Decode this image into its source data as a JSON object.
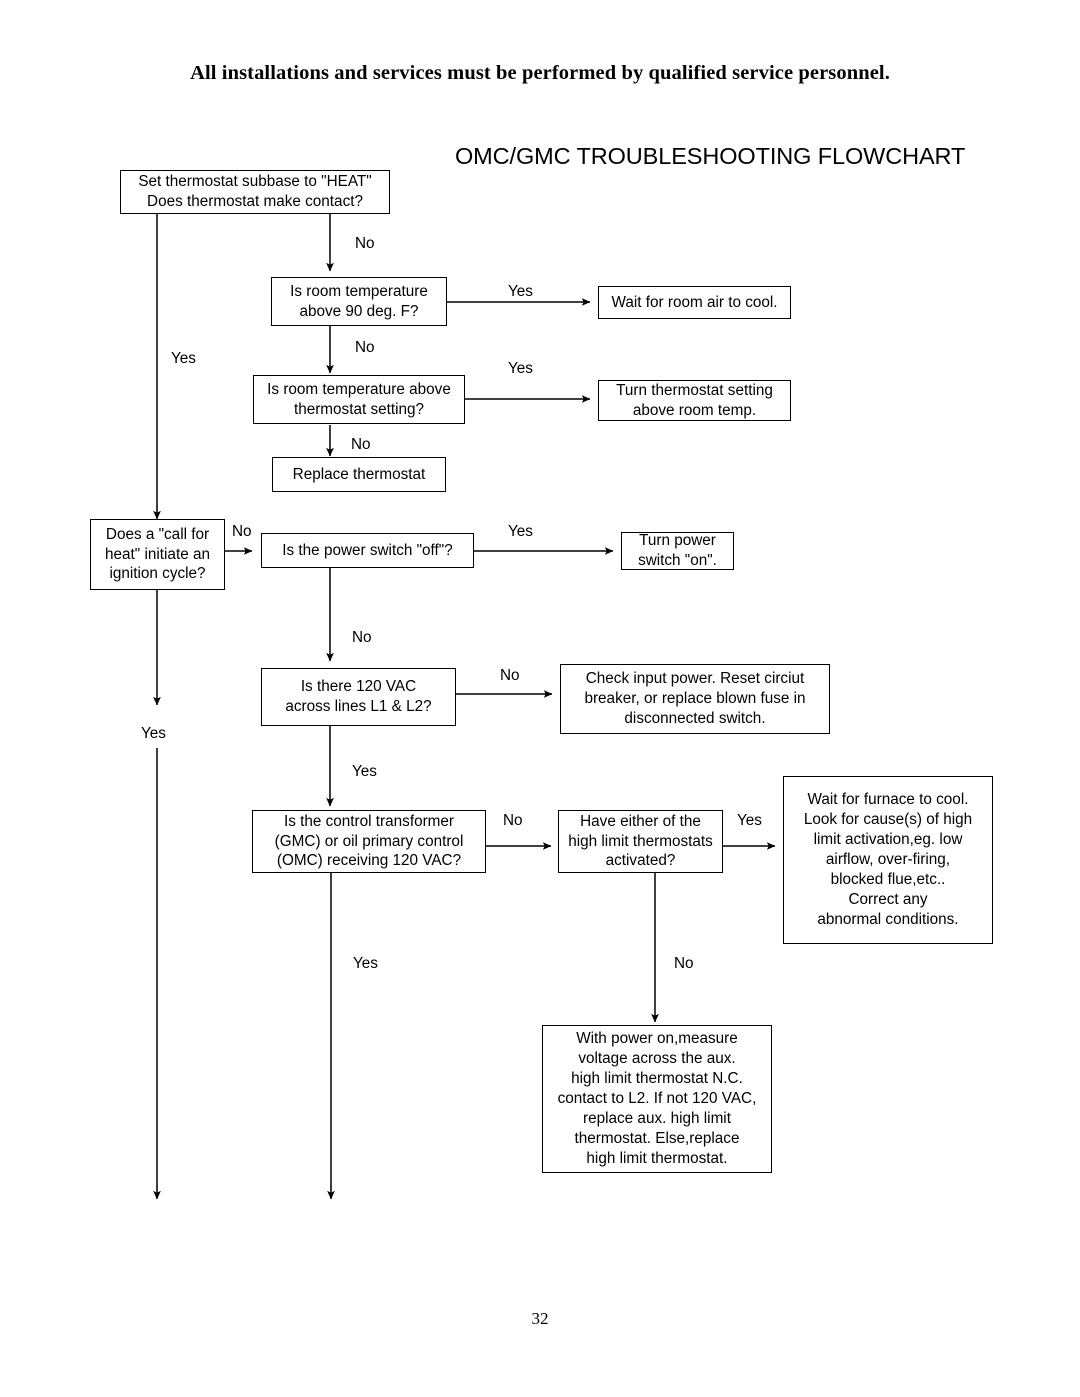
{
  "notice": "All installations and services must be performed by qualified service personnel.",
  "chart_title": "OMC/GMC TROUBLESHOOTING FLOWCHART",
  "page_number": "32",
  "nodes": [
    {
      "id": "set-thermostat",
      "text": "Set thermostat subbase to \"HEAT\"\nDoes thermostat make contact?"
    },
    {
      "id": "room-above-90",
      "text": "Is room temperature\nabove 90 deg. F?"
    },
    {
      "id": "wait-room-air-cool",
      "text": "Wait for room air to cool."
    },
    {
      "id": "room-above-setting",
      "text": "Is room temperature above\nthermostat setting?"
    },
    {
      "id": "turn-thermostat-up",
      "text": "Turn thermostat setting\nabove room temp."
    },
    {
      "id": "replace-thermostat",
      "text": "Replace thermostat"
    },
    {
      "id": "call-for-heat",
      "text": "Does a \"call for\nheat\" initiate an\nignition cycle?"
    },
    {
      "id": "power-switch-off",
      "text": "Is the power switch \"off\"?"
    },
    {
      "id": "turn-power-on",
      "text": "Turn power\nswitch \"on\"."
    },
    {
      "id": "is-120-vac-l1-l2",
      "text": "Is there 120 VAC\nacross lines L1 & L2?"
    },
    {
      "id": "check-input-power",
      "text": "Check input power. Reset circiut\nbreaker, or replace blown fuse in\ndisconnected switch."
    },
    {
      "id": "control-transformer",
      "text": "Is the control transformer\n(GMC) or oil primary control\n(OMC) receiving 120 VAC?"
    },
    {
      "id": "high-limit-activated",
      "text": "Have either of the\nhigh limit thermostats\nactivated?"
    },
    {
      "id": "wait-furnace-cool",
      "text": "Wait for furnace to cool.\nLook for cause(s) of high\nlimit  activation,eg. low\nairflow, over-firing,\nblocked flue,etc..\nCorrect any\nabnormal conditions."
    },
    {
      "id": "measure-aux-voltage",
      "text": "With power on,measure\nvoltage across the aux.\nhigh limit thermostat N.C.\ncontact to L2. If not 120 VAC,\nreplace aux. high limit\nthermostat. Else,replace\nhigh limit thermostat."
    }
  ],
  "edge_labels": [
    {
      "id": "no-thermostat-contact",
      "text": "No"
    },
    {
      "id": "yes-room-above-90",
      "text": "Yes"
    },
    {
      "id": "no-room-above-90",
      "text": "No"
    },
    {
      "id": "yes-thermostat-contact",
      "text": "Yes"
    },
    {
      "id": "yes-room-above-setting",
      "text": "Yes"
    },
    {
      "id": "no-room-above-setting",
      "text": "No"
    },
    {
      "id": "no-call-for-heat",
      "text": "No"
    },
    {
      "id": "yes-power-switch-off",
      "text": "Yes"
    },
    {
      "id": "no-power-switch-off",
      "text": "No"
    },
    {
      "id": "yes-call-for-heat",
      "text": "Yes"
    },
    {
      "id": "no-120-vac",
      "text": "No"
    },
    {
      "id": "yes-120-vac",
      "text": "Yes"
    },
    {
      "id": "no-control-transformer",
      "text": "No"
    },
    {
      "id": "yes-high-limit",
      "text": "Yes"
    },
    {
      "id": "yes-control-transformer",
      "text": "Yes"
    },
    {
      "id": "no-high-limit",
      "text": "No"
    }
  ],
  "colors": {
    "line": "#000000",
    "box_border": "#000000",
    "background": "#ffffff",
    "text": "#000000"
  }
}
